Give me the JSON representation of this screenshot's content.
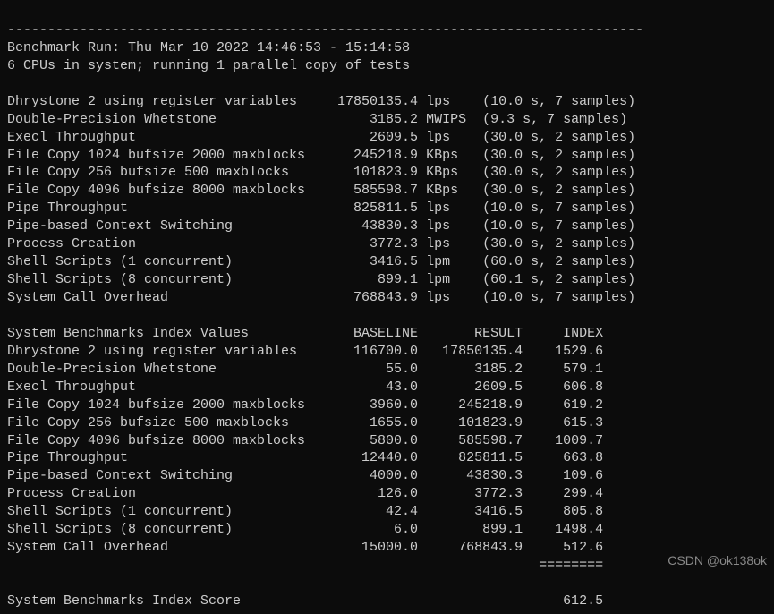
{
  "header": {
    "run_line": "Benchmark Run: Thu Mar 10 2022 14:46:53 - 15:14:58",
    "cpu_line": "6 CPUs in system; running 1 parallel copy of tests"
  },
  "runs": [
    {
      "name": "Dhrystone 2 using register variables",
      "value": "17850135.4",
      "unit": "lps",
      "details": "(10.0 s, 7 samples)"
    },
    {
      "name": "Double-Precision Whetstone",
      "value": "3185.2",
      "unit": "MWIPS",
      "details": "(9.3 s, 7 samples)"
    },
    {
      "name": "Execl Throughput",
      "value": "2609.5",
      "unit": "lps",
      "details": "(30.0 s, 2 samples)"
    },
    {
      "name": "File Copy 1024 bufsize 2000 maxblocks",
      "value": "245218.9",
      "unit": "KBps",
      "details": "(30.0 s, 2 samples)"
    },
    {
      "name": "File Copy 256 bufsize 500 maxblocks",
      "value": "101823.9",
      "unit": "KBps",
      "details": "(30.0 s, 2 samples)"
    },
    {
      "name": "File Copy 4096 bufsize 8000 maxblocks",
      "value": "585598.7",
      "unit": "KBps",
      "details": "(30.0 s, 2 samples)"
    },
    {
      "name": "Pipe Throughput",
      "value": "825811.5",
      "unit": "lps",
      "details": "(10.0 s, 7 samples)"
    },
    {
      "name": "Pipe-based Context Switching",
      "value": "43830.3",
      "unit": "lps",
      "details": "(10.0 s, 7 samples)"
    },
    {
      "name": "Process Creation",
      "value": "3772.3",
      "unit": "lps",
      "details": "(30.0 s, 2 samples)"
    },
    {
      "name": "Shell Scripts (1 concurrent)",
      "value": "3416.5",
      "unit": "lpm",
      "details": "(60.0 s, 2 samples)"
    },
    {
      "name": "Shell Scripts (8 concurrent)",
      "value": "899.1",
      "unit": "lpm",
      "details": "(60.1 s, 2 samples)"
    },
    {
      "name": "System Call Overhead",
      "value": "768843.9",
      "unit": "lps",
      "details": "(10.0 s, 7 samples)"
    }
  ],
  "index_header": {
    "title": "System Benchmarks Index Values",
    "baseline": "BASELINE",
    "result": "RESULT",
    "index": "INDEX"
  },
  "index": [
    {
      "name": "Dhrystone 2 using register variables",
      "baseline": "116700.0",
      "result": "17850135.4",
      "index": "1529.6"
    },
    {
      "name": "Double-Precision Whetstone",
      "baseline": "55.0",
      "result": "3185.2",
      "index": "579.1"
    },
    {
      "name": "Execl Throughput",
      "baseline": "43.0",
      "result": "2609.5",
      "index": "606.8"
    },
    {
      "name": "File Copy 1024 bufsize 2000 maxblocks",
      "baseline": "3960.0",
      "result": "245218.9",
      "index": "619.2"
    },
    {
      "name": "File Copy 256 bufsize 500 maxblocks",
      "baseline": "1655.0",
      "result": "101823.9",
      "index": "615.3"
    },
    {
      "name": "File Copy 4096 bufsize 8000 maxblocks",
      "baseline": "5800.0",
      "result": "585598.7",
      "index": "1009.7"
    },
    {
      "name": "Pipe Throughput",
      "baseline": "12440.0",
      "result": "825811.5",
      "index": "663.8"
    },
    {
      "name": "Pipe-based Context Switching",
      "baseline": "4000.0",
      "result": "43830.3",
      "index": "109.6"
    },
    {
      "name": "Process Creation",
      "baseline": "126.0",
      "result": "3772.3",
      "index": "299.4"
    },
    {
      "name": "Shell Scripts (1 concurrent)",
      "baseline": "42.4",
      "result": "3416.5",
      "index": "805.8"
    },
    {
      "name": "Shell Scripts (8 concurrent)",
      "baseline": "6.0",
      "result": "899.1",
      "index": "1498.4"
    },
    {
      "name": "System Call Overhead",
      "baseline": "15000.0",
      "result": "768843.9",
      "index": "512.6"
    }
  ],
  "separator": "========",
  "score": {
    "label": "System Benchmarks Index Score",
    "value": "612.5"
  },
  "watermark": "CSDN @ok138ok"
}
